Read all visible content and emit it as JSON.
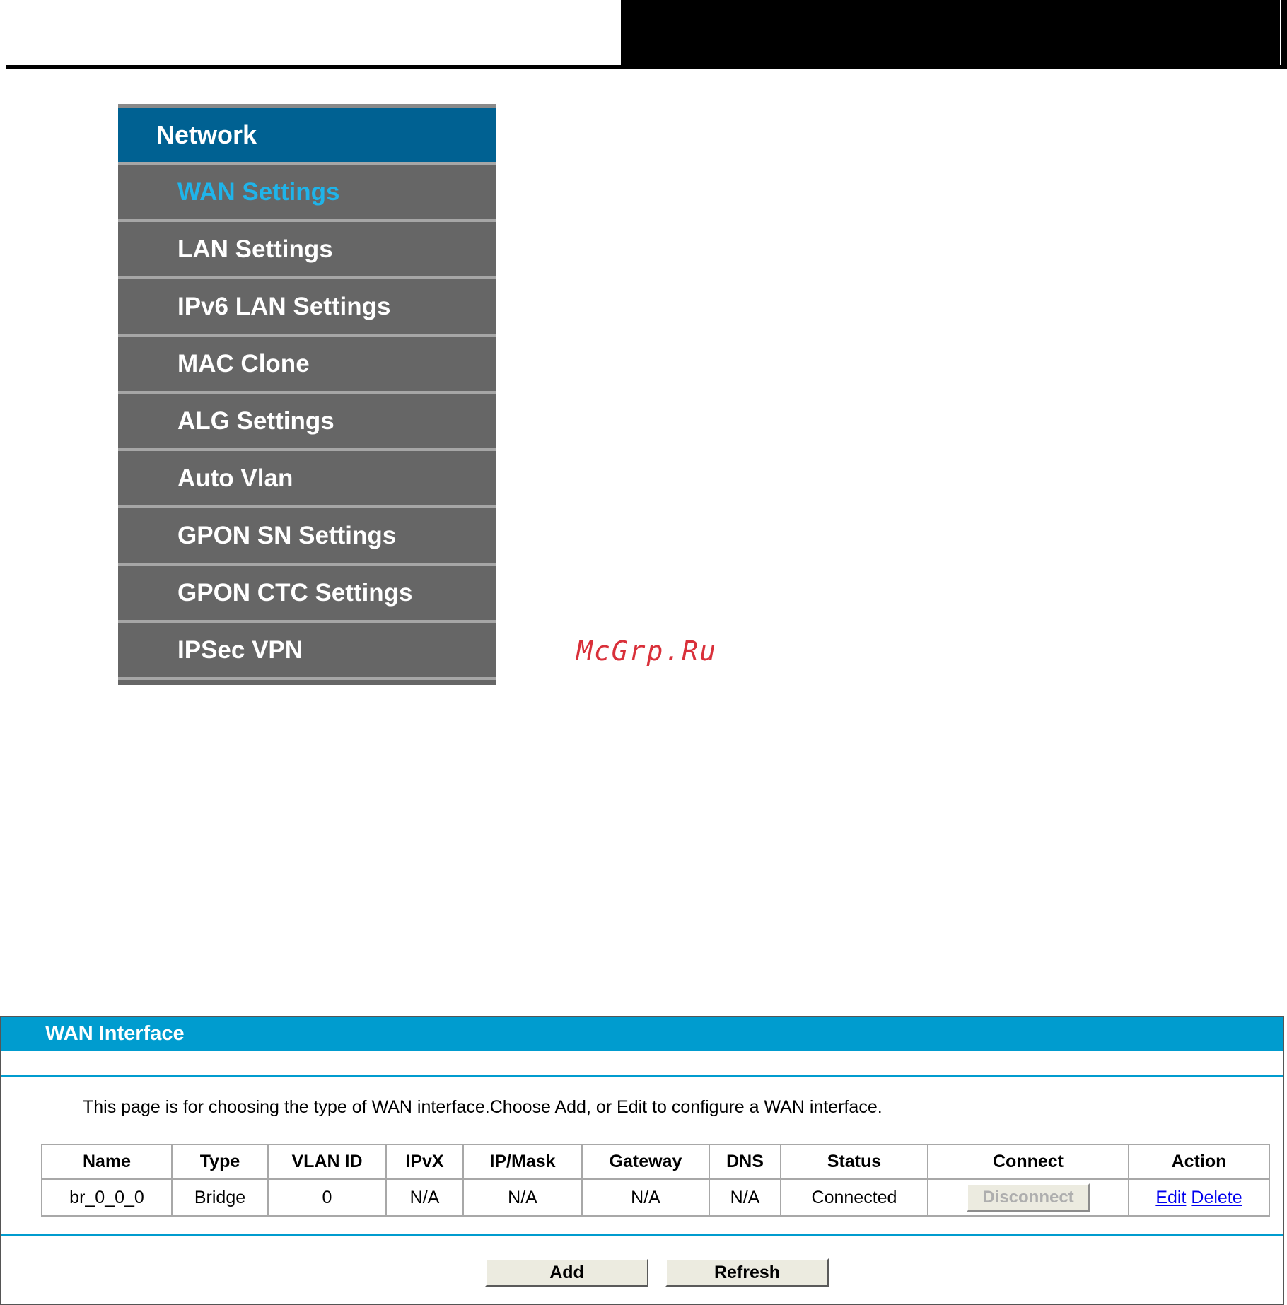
{
  "menu": {
    "title": "Network",
    "items": [
      {
        "label": "WAN Settings",
        "active": true
      },
      {
        "label": "LAN Settings",
        "active": false
      },
      {
        "label": "IPv6 LAN Settings",
        "active": false
      },
      {
        "label": "MAC Clone",
        "active": false
      },
      {
        "label": "ALG Settings",
        "active": false
      },
      {
        "label": "Auto Vlan",
        "active": false
      },
      {
        "label": "GPON SN Settings",
        "active": false
      },
      {
        "label": "GPON CTC Settings",
        "active": false
      },
      {
        "label": "IPSec VPN",
        "active": false
      }
    ]
  },
  "watermark": "McGrp.Ru",
  "wan": {
    "title": "WAN Interface",
    "description": "This page is for choosing the type of WAN interface.Choose Add, or Edit to configure a WAN interface.",
    "columns": [
      "Name",
      "Type",
      "VLAN ID",
      "IPvX",
      "IP/Mask",
      "Gateway",
      "DNS",
      "Status",
      "Connect",
      "Action"
    ],
    "rows": [
      {
        "name": "br_0_0_0",
        "type": "Bridge",
        "vlan_id": "0",
        "ipvx": "N/A",
        "ip_mask": "N/A",
        "gateway": "N/A",
        "dns": "N/A",
        "status": "Connected",
        "connect_label": "Disconnect",
        "edit_label": "Edit",
        "delete_label": "Delete"
      }
    ],
    "add_label": "Add",
    "refresh_label": "Refresh"
  },
  "colors": {
    "menu_header": "#006192",
    "menu_bg": "#666666",
    "menu_active": "#1fb4ea",
    "panel_accent": "#009ccf",
    "watermark": "#d9303a"
  }
}
